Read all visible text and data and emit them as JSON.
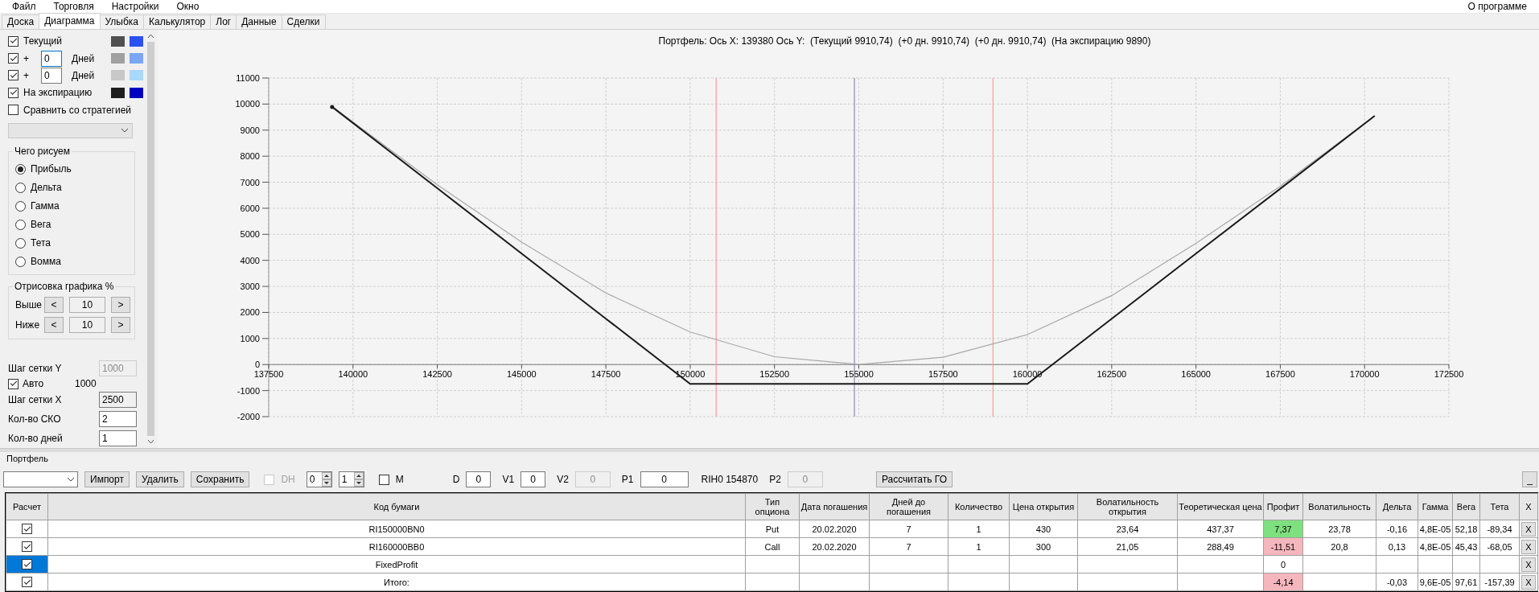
{
  "menu": {
    "items": [
      "Файл",
      "Торговля",
      "Настройки",
      "Окно"
    ],
    "about": "О программе"
  },
  "tabs": [
    {
      "label": "Доска",
      "selected": false
    },
    {
      "label": "Диаграмма",
      "selected": true
    },
    {
      "label": "Улыбка",
      "selected": false
    },
    {
      "label": "Калькулятор",
      "selected": false
    },
    {
      "label": "Лог",
      "selected": false
    },
    {
      "label": "Данные",
      "selected": false
    },
    {
      "label": "Сделки",
      "selected": false
    }
  ],
  "settings": {
    "series_toggles": [
      {
        "kind": "named",
        "checked": true,
        "label": "Текущий",
        "swatches": [
          {
            "color": "#505050"
          },
          {
            "color": "#2a52f0"
          }
        ]
      },
      {
        "kind": "days",
        "checked": true,
        "prefix": "+",
        "value": "0",
        "unit": "Дней",
        "focused": true,
        "swatches": [
          {
            "color": "#a0a0a0"
          },
          {
            "color": "#7aa6f5"
          }
        ]
      },
      {
        "kind": "days",
        "checked": true,
        "prefix": "+",
        "value": "0",
        "unit": "Дней",
        "focused": false,
        "swatches": [
          {
            "color": "#c8c8c8"
          },
          {
            "color": "#a8d8fa"
          }
        ]
      },
      {
        "kind": "named",
        "checked": true,
        "label": "На экспирацию",
        "swatches": [
          {
            "color": "#1e1e1e"
          },
          {
            "color": "#0000c0"
          }
        ]
      }
    ],
    "compare": {
      "label": "Сравнить со стратегией",
      "checked": false
    },
    "draw_group": {
      "title": "Чего рисуем",
      "options": [
        {
          "label": "Прибыль",
          "selected": true
        },
        {
          "label": "Дельта",
          "selected": false
        },
        {
          "label": "Гамма",
          "selected": false
        },
        {
          "label": "Вега",
          "selected": false
        },
        {
          "label": "Тета",
          "selected": false
        },
        {
          "label": "Вомма",
          "selected": false
        }
      ]
    },
    "range_group": {
      "title": "Отрисовка графика %",
      "rows": [
        {
          "label": "Выше",
          "dec": "<",
          "value": "10",
          "inc": ">"
        },
        {
          "label": "Ниже",
          "dec": "<",
          "value": "10",
          "inc": ">"
        }
      ]
    },
    "grid_fields": [
      {
        "kind": "field",
        "label": "Шаг сетки Y",
        "value": "1000",
        "disabled": true,
        "readonly": false
      },
      {
        "kind": "check",
        "label": "Авто",
        "checked": true,
        "value": "1000"
      },
      {
        "kind": "field",
        "label": "Шаг сетки X",
        "value": "2500",
        "disabled": false,
        "readonly": true
      },
      {
        "kind": "field",
        "label": "Кол-во СКО",
        "value": "2",
        "disabled": false,
        "readonly": false
      },
      {
        "kind": "field",
        "label": "Кол-во дней",
        "value": "1",
        "disabled": false,
        "readonly": false
      }
    ]
  },
  "chart": {
    "chart_data": {
      "type": "line",
      "title": "Портфель: Ось X: 139380 Ось Y:  (Текущий 9910,74)  (+0 дн. 9910,74)  (+0 дн. 9910,74)  (На экспирацию 9890)",
      "x": [
        139380,
        142500,
        145000,
        147500,
        150000,
        152500,
        155000,
        157500,
        160000,
        162500,
        165000,
        167500,
        170300
      ],
      "series": [
        {
          "color": "#a8a8a8",
          "values": [
            9910,
            6900,
            4700,
            2750,
            1250,
            300,
            0,
            280,
            1150,
            2650,
            4650,
            6850,
            9550
          ]
        },
        {
          "color": "#1a1a1a",
          "values": [
            9890,
            6770,
            4260,
            1760,
            -740,
            -740,
            -740,
            -740,
            -740,
            1760,
            4260,
            6750,
            9550
          ]
        }
      ],
      "xlim": [
        137500,
        172500
      ],
      "ylim": [
        -2000,
        11000
      ],
      "xticks": [
        137500,
        140000,
        142500,
        145000,
        147500,
        150000,
        152500,
        155000,
        157500,
        160000,
        162500,
        165000,
        167500,
        170000,
        172500
      ],
      "yticks": [
        -2000,
        -1000,
        0,
        1000,
        2000,
        3000,
        4000,
        5000,
        6000,
        7000,
        8000,
        9000,
        10000,
        11000
      ],
      "grid": true,
      "ref_lines": [
        {
          "axis": "x",
          "value": 150770,
          "color": "#ff9a9a"
        },
        {
          "axis": "x",
          "value": 154870,
          "color": "#7f8fb5"
        },
        {
          "axis": "x",
          "value": 158980,
          "color": "#ff9a9a"
        }
      ]
    }
  },
  "portfolio": {
    "title": "Портфель",
    "buttons": [
      "Импорт",
      "Удалить",
      "Сохранить"
    ],
    "dh": {
      "label": "DH",
      "checked": false,
      "disabled": true
    },
    "spinners": [
      "0",
      "1"
    ],
    "m": {
      "label": "M",
      "checked": false
    },
    "params": [
      {
        "kind": "param",
        "label": "D",
        "value": "0",
        "disabled": false
      },
      {
        "kind": "param",
        "label": "V1",
        "value": "0",
        "disabled": false
      },
      {
        "kind": "param",
        "label": "V2",
        "value": "0",
        "disabled": true
      },
      {
        "kind": "param",
        "label": "P1",
        "value": "0",
        "disabled": false
      },
      {
        "kind": "info",
        "label": "RIH0 154870"
      },
      {
        "kind": "param",
        "label": "P2",
        "value": "0",
        "disabled": true
      }
    ],
    "calc_button": "Рассчитать ГО",
    "minimize": "_",
    "table": {
      "columns": [
        "Расчет",
        "Код бумаги",
        "Тип опциона",
        "Дата погашения",
        "Дней до погашения",
        "Количество",
        "Цена открытия",
        "Волатильность открытия",
        "Теоретическая цена",
        "Профит",
        "Волатильность",
        "Дельта",
        "Гамма",
        "Вега",
        "Тета",
        "X"
      ],
      "rows": [
        {
          "selected": false,
          "color": "#7fe07f",
          "cells": [
            {
              "checked": true
            },
            "RI150000BN0",
            "Put",
            "20.02.2020",
            "7",
            "1",
            "430",
            "23,64",
            "437,37",
            "7,37",
            "23,78",
            "-0,16",
            "4,8E-05",
            "52,18",
            "-89,34",
            "X"
          ]
        },
        {
          "selected": false,
          "color": "#f6b6be",
          "cells": [
            {
              "checked": true
            },
            "RI160000BB0",
            "Call",
            "20.02.2020",
            "7",
            "1",
            "300",
            "21,05",
            "288,49",
            "-11,51",
            "20,8",
            "0,13",
            "4,8E-05",
            "45,43",
            "-68,05",
            "X"
          ]
        },
        {
          "selected": true,
          "cells": [
            {
              "checked": true
            },
            "FixedProfit",
            "",
            "",
            "",
            "",
            "",
            "",
            "",
            "0",
            "",
            "",
            "",
            "",
            "",
            "X"
          ]
        },
        {
          "selected": false,
          "color": "#f6b6be",
          "cells": [
            {
              "checked": true
            },
            "Итого:",
            "",
            "",
            "",
            "",
            "",
            "",
            "",
            "-4,14",
            "",
            "-0,03",
            "9,6E-05",
            "97,61",
            "-157,39",
            "X"
          ]
        }
      ]
    }
  }
}
